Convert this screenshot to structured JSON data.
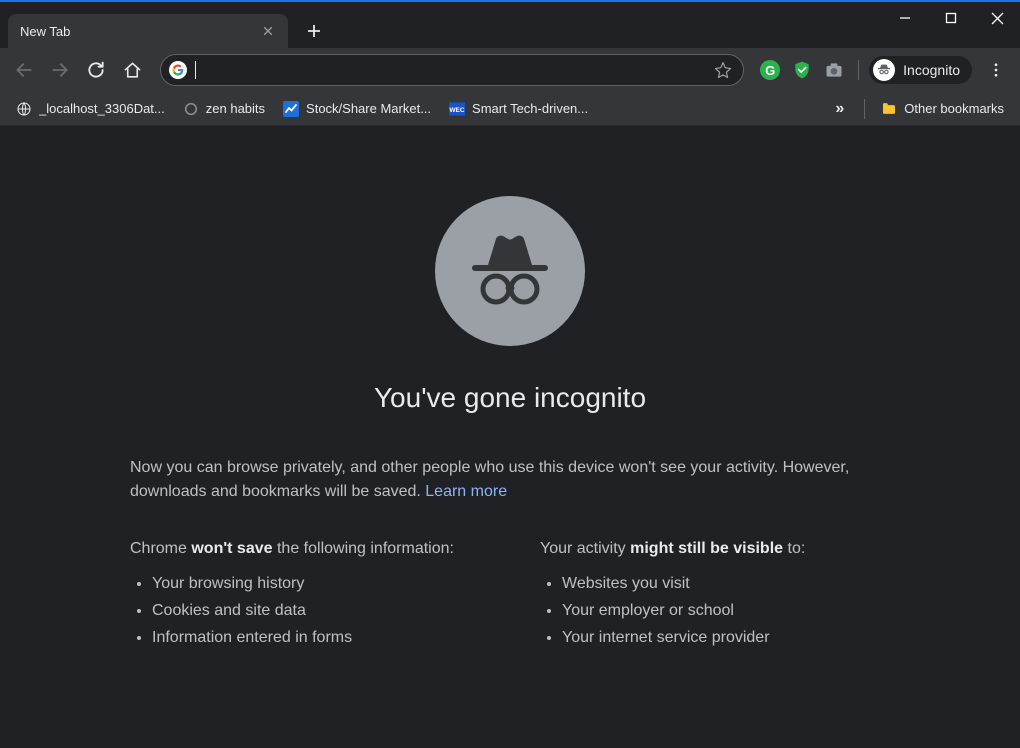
{
  "tab": {
    "title": "New Tab"
  },
  "toolbar": {
    "incognito_label": "Incognito"
  },
  "bookmarks": {
    "items": [
      {
        "label": "_localhost_3306Dat..."
      },
      {
        "label": "zen habits"
      },
      {
        "label": "Stock/Share Market..."
      },
      {
        "label": "Smart Tech-driven..."
      }
    ],
    "overflow": "»",
    "other": "Other bookmarks"
  },
  "content": {
    "heading": "You've gone incognito",
    "intro_1": "Now you can browse privately, and other people who use this device won't see your activity. However, downloads and bookmarks will be saved. ",
    "learn_more": "Learn more",
    "col1": {
      "pre": "Chrome ",
      "strong": "won't save",
      "post": " the following information:",
      "items": [
        "Your browsing history",
        "Cookies and site data",
        "Information entered in forms"
      ]
    },
    "col2": {
      "pre": "Your activity ",
      "strong": "might still be visible",
      "post": " to:",
      "items": [
        "Websites you visit",
        "Your employer or school",
        "Your internet service provider"
      ]
    }
  }
}
